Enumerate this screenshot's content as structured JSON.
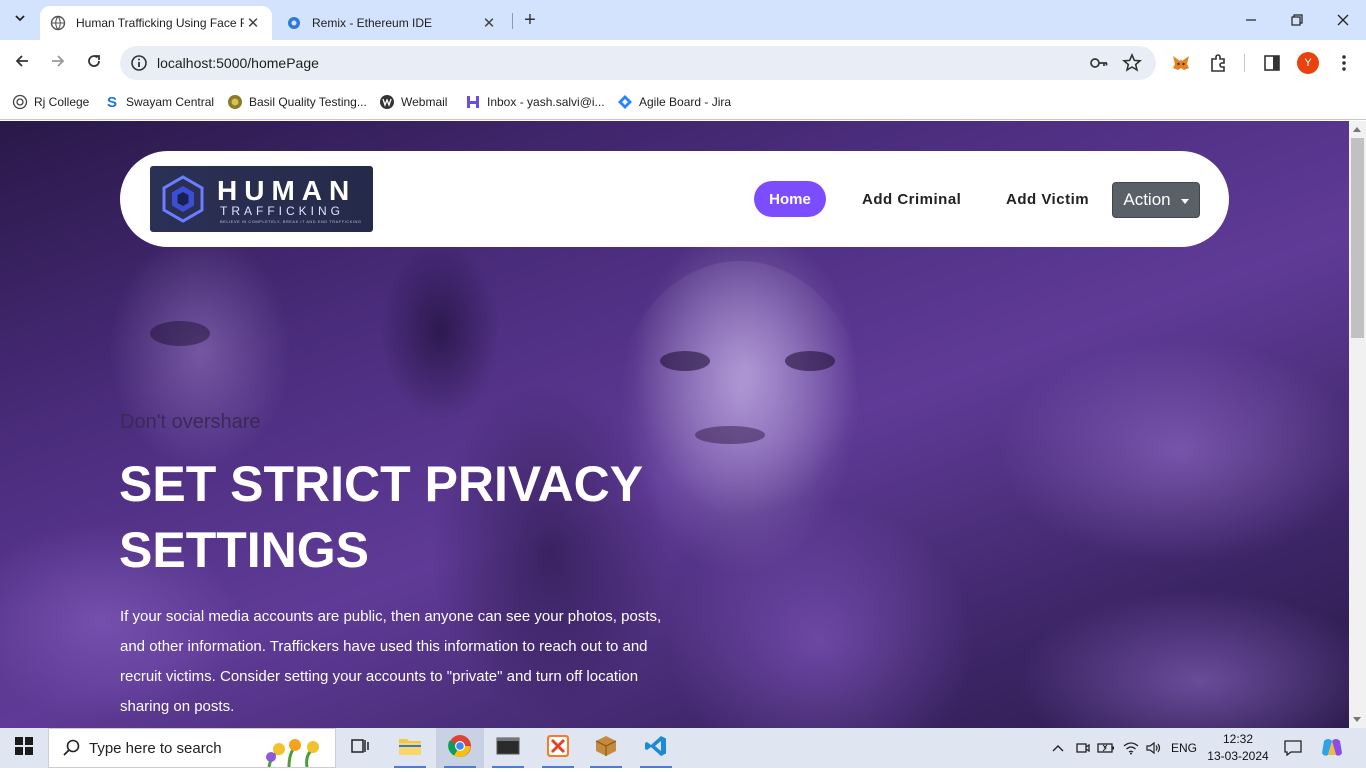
{
  "browser": {
    "tabs": [
      {
        "title": "Human Trafficking Using Face R",
        "active": true
      },
      {
        "title": "Remix - Ethereum IDE",
        "active": false
      }
    ],
    "url": "localhost:5000/homePage",
    "profile_initial": "Y",
    "bookmarks": [
      {
        "label": "Rj College",
        "icon": "rj-college-icon"
      },
      {
        "label": "Swayam Central",
        "icon": "swayam-icon"
      },
      {
        "label": "Basil Quality Testing...",
        "icon": "basil-icon"
      },
      {
        "label": "Webmail",
        "icon": "webmail-icon"
      },
      {
        "label": "Inbox - yash.salvi@i...",
        "icon": "inbox-icon"
      },
      {
        "label": "Agile Board - Jira",
        "icon": "jira-icon"
      }
    ]
  },
  "page": {
    "logo": {
      "line1": "HUMAN",
      "line2": "TRAFFICKING",
      "line3": "BELIEVE IN COMPLETELY, BREAK IT AND END TRAFFICKING"
    },
    "nav": {
      "home": "Home",
      "add_criminal": "Add Criminal",
      "add_victim": "Add Victim",
      "action": "Action"
    },
    "hero": {
      "subtitle": "Don't overshare",
      "title": "SET STRICT PRIVACY SETTINGS",
      "body": "If your social media accounts are public, then anyone can see your photos, posts, and other information. Traffickers have used this information to reach out to and recruit victims. Consider setting your accounts to \"private\" and turn off location sharing on posts."
    },
    "accent_color": "#7c4dff"
  },
  "taskbar": {
    "search_placeholder": "Type here to search",
    "language": "ENG",
    "time": "12:32",
    "date": "13-03-2024"
  }
}
